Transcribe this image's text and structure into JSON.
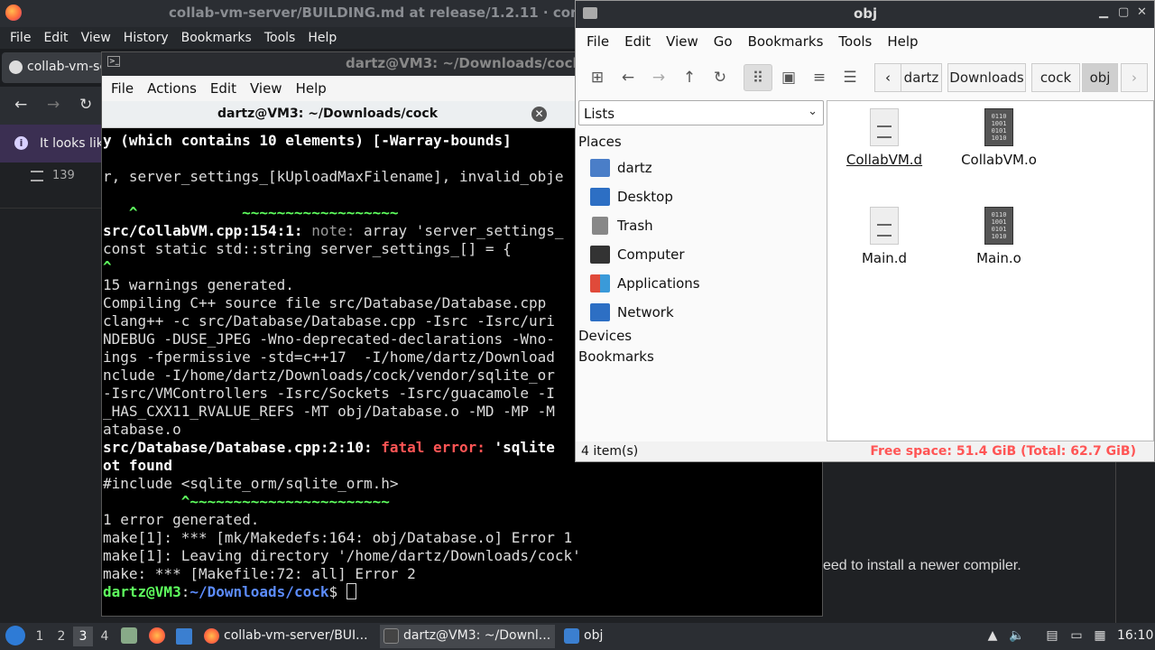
{
  "firefox": {
    "title": "collab-vm-server/BUILDING.md at release/1.2.11 · com",
    "menu": [
      "File",
      "Edit",
      "View",
      "History",
      "Bookmarks",
      "Tools",
      "Help"
    ],
    "tab_label": "collab-vm-se",
    "notice": "It looks lik",
    "lines_count": "139",
    "compiler_text": "eed to install a newer compiler."
  },
  "terminal": {
    "window_title": "dartz@VM3: ~/Downloads/cock",
    "menu": [
      "File",
      "Actions",
      "Edit",
      "View",
      "Help"
    ],
    "tab_title": "dartz@VM3: ~/Downloads/cock",
    "prompt_user": "dartz@VM3",
    "prompt_path": "~/Downloads/cock",
    "lines": {
      "l0": "y (which contains 10 elements) [-Warray-bounds]",
      "l2": "r, server_settings_[kUploadMaxFilename], invalid_obje",
      "l4a": "   ^",
      "l4b": "            ~~~~~~~~~~~~~~~~~~",
      "l5a": "src/CollabVM.cpp:154:1: ",
      "l5b": "note: ",
      "l5c": "array 'server_settings_",
      "l6": "const static std::string server_settings_[] = {",
      "l7": "^",
      "l8": "15 warnings generated.",
      "l9": "Compiling C++ source file src/Database/Database.cpp",
      "l10": "clang++ -c src/Database/Database.cpp -Isrc -Isrc/uri",
      "l11": "NDEBUG -DUSE_JPEG -Wno-deprecated-declarations -Wno-",
      "l12": "ings -fpermissive -std=c++17  -I/home/dartz/Download",
      "l13": "nclude -I/home/dartz/Downloads/cock/vendor/sqlite_or",
      "l14": "-Isrc/VMControllers -Isrc/Sockets -Isrc/guacamole -I",
      "l15": "_HAS_CXX11_RVALUE_REFS -MT obj/Database.o -MD -MP -M",
      "l16": "atabase.o",
      "l17a": "src/Database/Database.cpp:2:10: ",
      "l17b": "fatal error: ",
      "l17c": "'sqlite",
      "l18": "ot found",
      "l19": "#include <sqlite_orm/sqlite_orm.h>",
      "l20": "         ^~~~~~~~~~~~~~~~~~~~~~~~",
      "l21": "1 error generated.",
      "l22": "make[1]: *** [mk/Makedefs:164: obj/Database.o] Error 1",
      "l23": "make[1]: Leaving directory '/home/dartz/Downloads/cock'",
      "l24": "make: *** [Makefile:72: all] Error 2"
    }
  },
  "filemanager": {
    "title": "obj",
    "menu": [
      "File",
      "Edit",
      "View",
      "Go",
      "Bookmarks",
      "Tools",
      "Help"
    ],
    "breadcrumbs": [
      "dartz",
      "Downloads",
      "cock",
      "obj"
    ],
    "side_selector": "Lists",
    "places_heading": "Places",
    "places": [
      "dartz",
      "Desktop",
      "Trash",
      "Computer",
      "Applications",
      "Network"
    ],
    "devices_heading": "Devices",
    "bookmarks_heading": "Bookmarks",
    "files": [
      "CollabVM.d",
      "CollabVM.o",
      "Main.d",
      "Main.o"
    ],
    "status_left": "4 item(s)",
    "status_right": "Free space: 51.4 GiB (Total: 62.7 GiB)"
  },
  "taskbar": {
    "workspaces": [
      "1",
      "2",
      "3",
      "4"
    ],
    "tasks": [
      "collab-vm-server/BUI...",
      "dartz@VM3: ~/Downl...",
      "obj"
    ],
    "clock": "16:10"
  }
}
